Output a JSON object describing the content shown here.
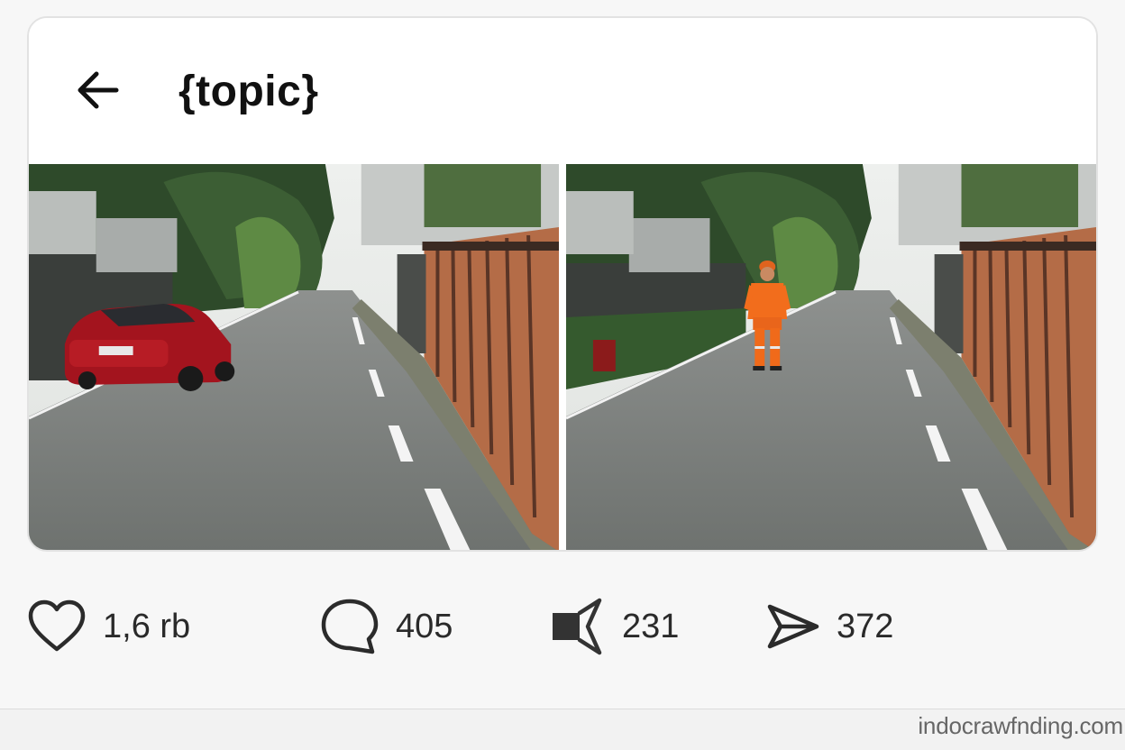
{
  "header": {
    "back_icon": "arrow-left-icon",
    "title": "{topic}"
  },
  "photos": [
    {
      "name": "street-with-red-car",
      "scene": "red car parked on residential street"
    },
    {
      "name": "street-with-worker",
      "scene": "worker in orange uniform standing on residential street"
    }
  ],
  "actions": {
    "like": {
      "icon": "heart-icon",
      "count": "1,6 rb"
    },
    "comment": {
      "icon": "comment-bubble-icon",
      "count": "405"
    },
    "repost": {
      "icon": "megaphone-icon",
      "count": "231"
    },
    "share": {
      "icon": "send-icon",
      "count": "372"
    }
  },
  "watermark": "indocrawfnding.com",
  "colors": {
    "background": "#f7f7f7",
    "card": "#ffffff",
    "text": "#111111",
    "icon": "#2b2b2b"
  }
}
